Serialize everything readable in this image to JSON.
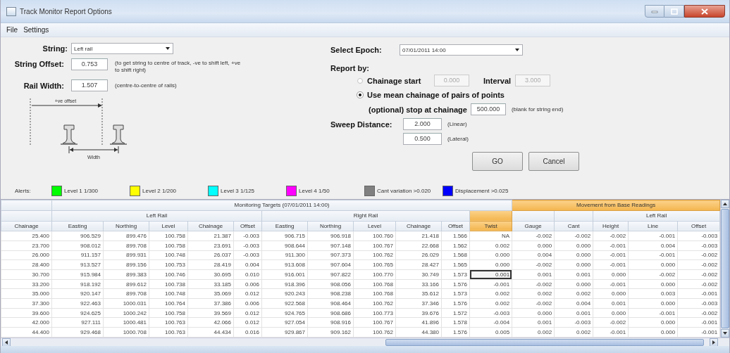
{
  "window": {
    "title": "Track Monitor Report Options"
  },
  "menu": [
    "File",
    "Settings"
  ],
  "string": {
    "label": "String:",
    "value": "Left rail"
  },
  "string_offset": {
    "label": "String Offset:",
    "value": "0.753",
    "note": "(to get string to centre of track, -ve to shift left, +ve to shift right)"
  },
  "rail_width": {
    "label": "Rail Width:",
    "value": "1.507",
    "note": "(centre-to-centre of rails)"
  },
  "diagram": {
    "offset_label": "+ve offset",
    "width_label": "Width"
  },
  "epoch": {
    "label": "Select Epoch:",
    "value": "07/01/2011 14:00"
  },
  "report_by": {
    "label": "Report by:",
    "options": [
      {
        "label": "Chainage start",
        "selected": false,
        "fields": [
          {
            "value": "0.000",
            "disabled": true
          },
          {
            "label": "Interval",
            "value": "3.000",
            "disabled": true
          }
        ]
      },
      {
        "label": "Use mean chainage of pairs of points",
        "selected": true
      }
    ],
    "stop": {
      "label": "(optional) stop at chainage",
      "value": "500.000",
      "note": "(blank for string end)"
    }
  },
  "sweep": {
    "label": "Sweep Distance:",
    "fields": [
      {
        "value": "2.000",
        "note": "(Linear)"
      },
      {
        "value": "0.500",
        "note": "(Lateral)"
      }
    ]
  },
  "buttons": [
    "GO",
    "Cancel"
  ],
  "alerts": {
    "label": "Alerts:",
    "items": [
      {
        "label": "Level 1 1/300",
        "color": "#00ff00"
      },
      {
        "label": "Level 2 1/200",
        "color": "#ffff00"
      },
      {
        "label": "Level 3 1/125",
        "color": "#00ffff"
      },
      {
        "label": "Level 4 1/50",
        "color": "#ff00ff"
      },
      {
        "label": "Cant variation >0.020",
        "color": "#808080"
      },
      {
        "label": "Displacement >0.025",
        "color": "#0000ff"
      }
    ]
  },
  "table": {
    "top_headers": [
      "Monitoring Targets (07/01/2011 14:00)",
      "Movement from Base Readings"
    ],
    "sub_headers": [
      "Left Rail",
      "Right Rail",
      "Left Rail"
    ],
    "columns": [
      {
        "label": "Chainage",
        "selected": false
      },
      {
        "label": "Easting",
        "selected": false
      },
      {
        "label": "Northing",
        "selected": false
      },
      {
        "label": "Level",
        "selected": false
      },
      {
        "label": "Chainage",
        "selected": false
      },
      {
        "label": "Offset",
        "selected": false
      },
      {
        "label": "Easting",
        "selected": false
      },
      {
        "label": "Northing",
        "selected": false
      },
      {
        "label": "Level",
        "selected": false
      },
      {
        "label": "Chainage",
        "selected": false
      },
      {
        "label": "Offset",
        "selected": false
      },
      {
        "label": "Twist",
        "selected": true
      },
      {
        "label": "Gauge",
        "selected": false
      },
      {
        "label": "Cant",
        "selected": false
      },
      {
        "label": "Height",
        "selected": false
      },
      {
        "label": "Line",
        "selected": false
      },
      {
        "label": "Offset",
        "selected": false
      }
    ],
    "rows": [
      {
        "focused": false,
        "cells": [
          "25.400",
          "906.529",
          "899.476",
          "100.758",
          "21.387",
          "-0.003",
          "906.715",
          "906.918",
          "100.760",
          "21.418",
          "1.566",
          "NA",
          "-0.002",
          "-0.002",
          "-0.002",
          "-0.001",
          "-0.003"
        ]
      },
      {
        "focused": false,
        "cells": [
          "23.700",
          "908.012",
          "899.708",
          "100.758",
          "23.691",
          "-0.003",
          "908.644",
          "907.148",
          "100.767",
          "22.668",
          "1.562",
          "0.002",
          "0.000",
          "0.000",
          "-0.001",
          "0.004",
          "-0.003"
        ]
      },
      {
        "focused": false,
        "cells": [
          "26.000",
          "911.157",
          "899.931",
          "100.748",
          "26.037",
          "-0.003",
          "911.300",
          "907.373",
          "100.762",
          "26.029",
          "1.568",
          "0.000",
          "0.004",
          "0.000",
          "-0.001",
          "-0.001",
          "-0.002"
        ]
      },
      {
        "focused": false,
        "cells": [
          "28.400",
          "913.527",
          "899.156",
          "100.753",
          "28.419",
          "0.004",
          "913.608",
          "907.604",
          "100.765",
          "28.427",
          "1.565",
          "0.000",
          "-0.002",
          "0.000",
          "-0.001",
          "0.000",
          "-0.002"
        ]
      },
      {
        "focused": true,
        "cells": [
          "30.700",
          "915.984",
          "899.383",
          "100.746",
          "30.695",
          "0.010",
          "916.001",
          "907.822",
          "100.770",
          "30.749",
          "1.573",
          "0.001",
          "0.001",
          "0.001",
          "0.000",
          "-0.002",
          "-0.002"
        ]
      },
      {
        "focused": false,
        "cells": [
          "33.200",
          "918.192",
          "899.612",
          "100.738",
          "33.185",
          "0.006",
          "918.396",
          "908.056",
          "100.768",
          "33.166",
          "1.576",
          "-0.001",
          "-0.002",
          "0.000",
          "-0.001",
          "0.000",
          "-0.002"
        ]
      },
      {
        "focused": false,
        "cells": [
          "35.000",
          "920.147",
          "899.708",
          "100.748",
          "35.069",
          "0.012",
          "920.243",
          "908.238",
          "100.768",
          "35.612",
          "1.573",
          "0.002",
          "0.002",
          "0.002",
          "0.000",
          "0.003",
          "-0.001"
        ]
      },
      {
        "focused": false,
        "cells": [
          "37.300",
          "922.463",
          "1000.031",
          "100.764",
          "37.386",
          "0.006",
          "922.568",
          "908.464",
          "100.762",
          "37.346",
          "1.576",
          "0.002",
          "-0.002",
          "0.004",
          "0.001",
          "0.000",
          "-0.003"
        ]
      },
      {
        "focused": false,
        "cells": [
          "39.600",
          "924.625",
          "1000.242",
          "100.758",
          "39.569",
          "0.012",
          "924.765",
          "908.686",
          "100.773",
          "39.676",
          "1.572",
          "-0.003",
          "0.000",
          "0.001",
          "0.000",
          "-0.001",
          "-0.002"
        ]
      },
      {
        "focused": false,
        "cells": [
          "42.000",
          "927.111",
          "1000.481",
          "100.763",
          "42.066",
          "0.012",
          "927.054",
          "908.916",
          "100.767",
          "41.896",
          "1.578",
          "-0.004",
          "0.001",
          "-0.003",
          "-0.002",
          "0.000",
          "-0.001"
        ]
      },
      {
        "focused": false,
        "cells": [
          "44.400",
          "929.468",
          "1000.708",
          "100.763",
          "44.434",
          "0.016",
          "929.867",
          "909.162",
          "100.762",
          "44.380",
          "1.576",
          "0.005",
          "0.002",
          "0.002",
          "-0.001",
          "0.000",
          "-0.001"
        ]
      }
    ]
  }
}
